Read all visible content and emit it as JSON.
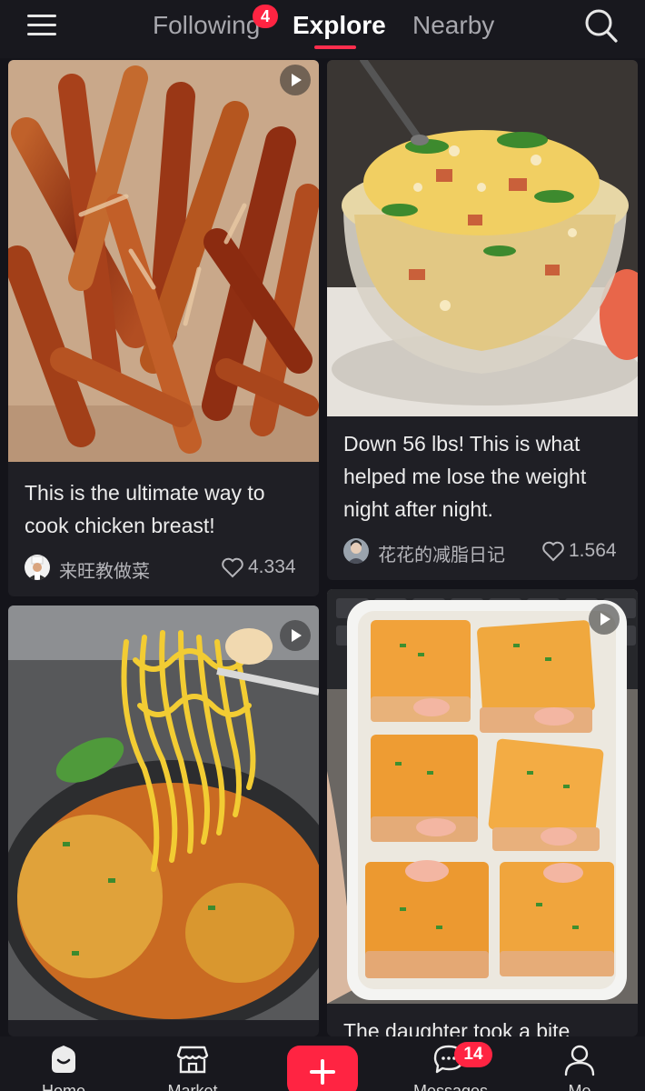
{
  "header": {
    "tabs": [
      {
        "label": "Following",
        "badge": "4"
      },
      {
        "label": "Explore",
        "active": true
      },
      {
        "label": "Nearby"
      }
    ],
    "accent_color": "#ff2442"
  },
  "feed": {
    "cards": [
      {
        "title": "This is the ultimate way to cook chicken breast!",
        "author": "来旺教做菜",
        "likes": "4.334",
        "video": true,
        "image_subject": "glazed-chicken-strips"
      },
      {
        "title": "Down 56 lbs! This is what helped me lose the weight night after night.",
        "author": "花花的减脂日记",
        "likes": "1.564",
        "video": false,
        "image_subject": "fried-rice-bowl"
      },
      {
        "title": "",
        "video": true,
        "image_subject": "ramen-noodles-pot"
      },
      {
        "title": "The daughter took a bite",
        "video": true,
        "image_subject": "shrimp-toast-box"
      }
    ]
  },
  "bottom_nav": {
    "items": [
      {
        "label": "Home",
        "icon": "home-icon"
      },
      {
        "label": "Market",
        "icon": "store-icon"
      },
      {
        "label": "",
        "icon": "plus-icon"
      },
      {
        "label": "Messages",
        "icon": "chat-bubble-icon",
        "badge": "14"
      },
      {
        "label": "Me",
        "icon": "profile-icon"
      }
    ]
  }
}
